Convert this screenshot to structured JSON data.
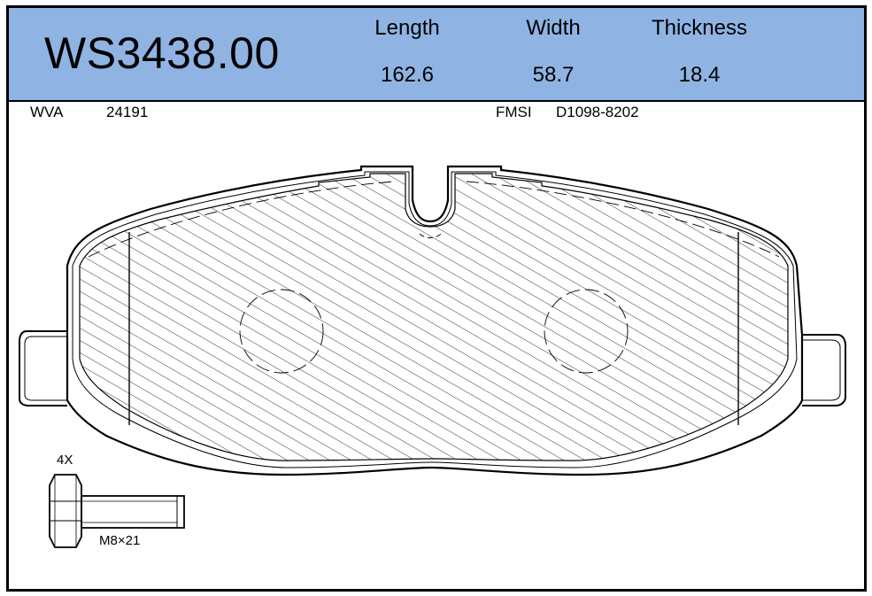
{
  "header": {
    "part_number": "WS3438.00",
    "dimensions": [
      {
        "label": "Length",
        "value": "162.6"
      },
      {
        "label": "Width",
        "value": "58.7"
      },
      {
        "label": "Thickness",
        "value": "18.4"
      }
    ]
  },
  "references": {
    "wva_label": "WVA",
    "wva_value": "24191",
    "fmsi_label": "FMSI",
    "fmsi_value": "D1098-8202"
  },
  "bolt": {
    "quantity": "4X",
    "size": "M8×21"
  },
  "colors": {
    "header_bg": "#8fb4e3",
    "line": "#000000"
  }
}
